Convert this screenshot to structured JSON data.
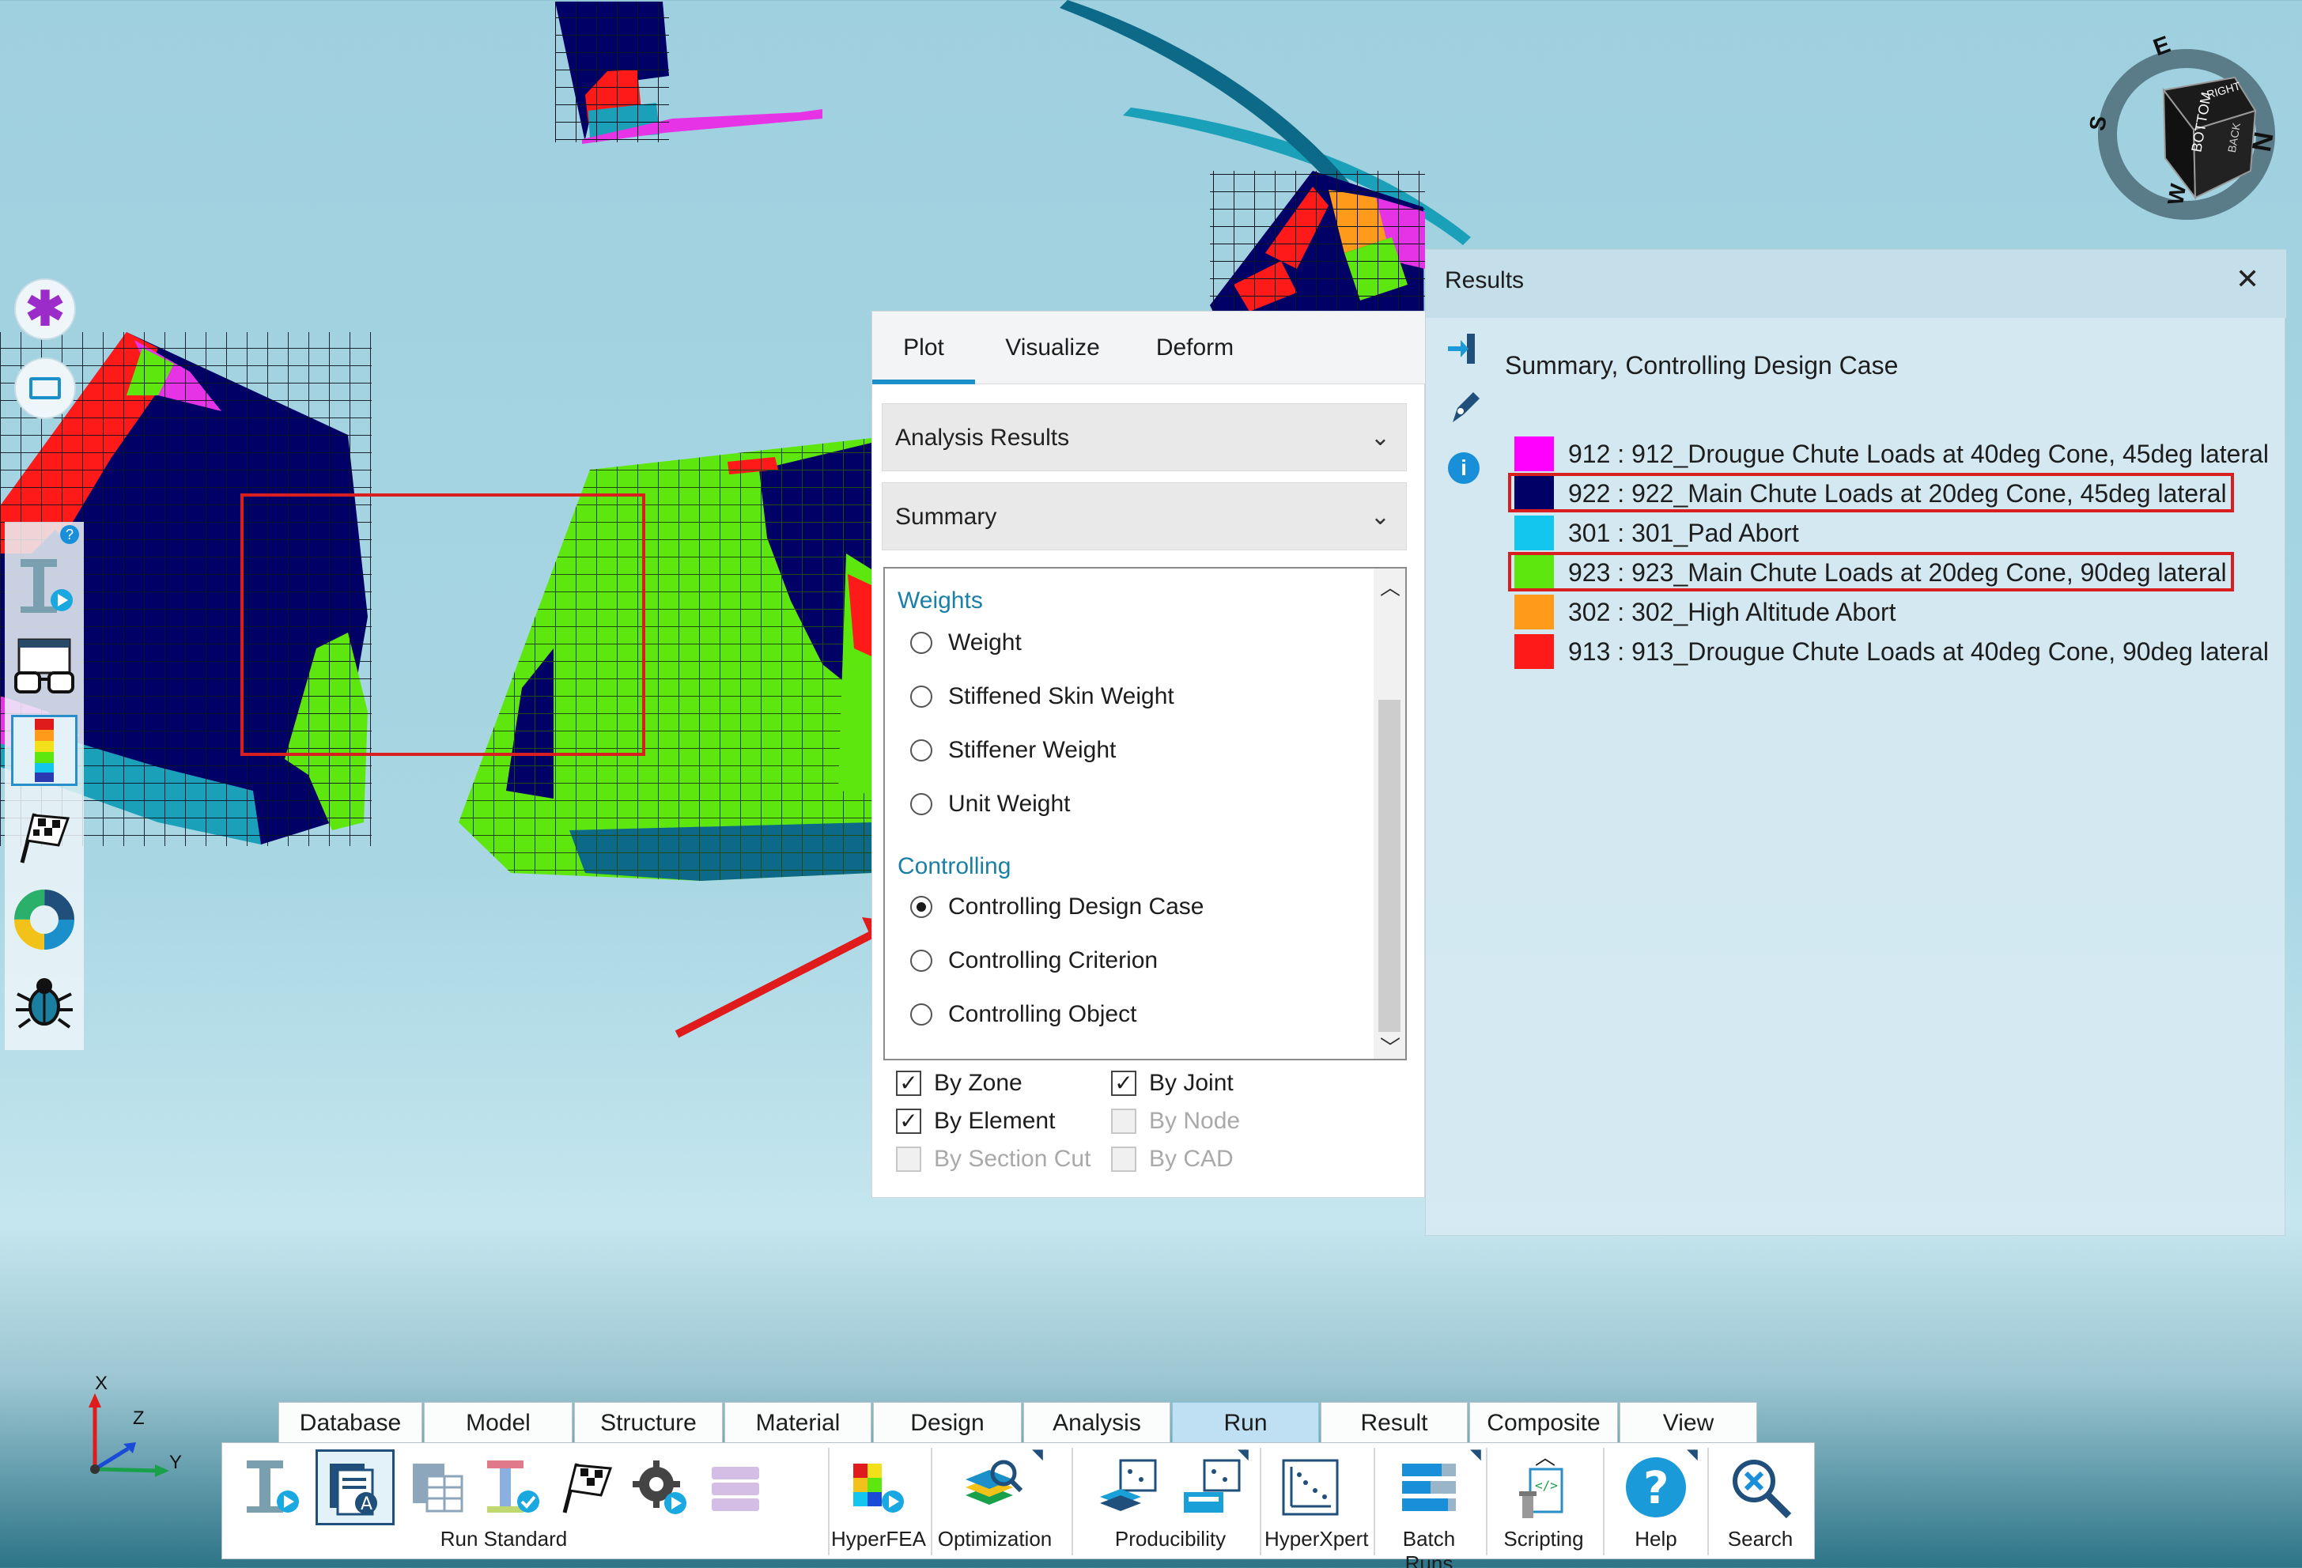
{
  "left_toolbar": {
    "help_badge": "?",
    "icons": [
      "asterisk-icon",
      "rectangle-icon",
      "run-icon",
      "glasses-icon",
      "color-legend-icon",
      "checkered-flag-icon",
      "donut-chart-icon",
      "bug-icon"
    ]
  },
  "plot_panel": {
    "tabs": [
      "Plot",
      "Visualize",
      "Deform"
    ],
    "active_tab": "Plot",
    "dropdown_1": "Analysis Results",
    "dropdown_2": "Summary",
    "sections": {
      "weights_header": "Weights",
      "weights": [
        "Weight",
        "Stiffened Skin Weight",
        "Stiffener Weight",
        "Unit Weight"
      ],
      "controlling_header": "Controlling",
      "controlling": [
        "Controlling Design Case",
        "Controlling Criterion",
        "Controlling Object"
      ],
      "selected": "Controlling Design Case"
    },
    "checkboxes": [
      {
        "label": "By Zone",
        "checked": true,
        "enabled": true
      },
      {
        "label": "By Joint",
        "checked": true,
        "enabled": true
      },
      {
        "label": "By Element",
        "checked": true,
        "enabled": true
      },
      {
        "label": "By Node",
        "checked": false,
        "enabled": false
      },
      {
        "label": "By Section Cut",
        "checked": false,
        "enabled": false
      },
      {
        "label": "By CAD",
        "checked": false,
        "enabled": false
      }
    ]
  },
  "results_panel": {
    "title": "Results",
    "close": "✕",
    "subtitle": "Summary, Controlling Design Case",
    "legend": [
      {
        "label": "912 : 912_Drougue Chute Loads at 40deg Cone, 45deg lateral",
        "color": "#ff00ff"
      },
      {
        "label": "922 : 922_Main Chute Loads at 20deg Cone, 45deg lateral",
        "color": "#000066"
      },
      {
        "label": "301 : 301_Pad Abort",
        "color": "#12c6ee"
      },
      {
        "label": "923 : 923_Main Chute Loads at 20deg Cone, 90deg lateral",
        "color": "#5de70f"
      },
      {
        "label": "302 : 302_High Altitude Abort",
        "color": "#ff9a1a"
      },
      {
        "label": "913 : 913_Drougue Chute Loads at 40deg Cone, 90deg lateral",
        "color": "#ff1a1a"
      }
    ]
  },
  "view_cube": {
    "face_bottom": "BOTTOM",
    "face_right": "RIGHT",
    "face_back": "BACK",
    "compass": [
      "E",
      "N",
      "S",
      "W"
    ]
  },
  "axis_triad": {
    "x": "X",
    "y": "Y",
    "z": "Z"
  },
  "ribbon": {
    "tabs": [
      "Database",
      "Model",
      "Structure",
      "Material",
      "Design",
      "Analysis",
      "Run",
      "Result",
      "Composite",
      "View"
    ],
    "active_tab": "Run",
    "groups": {
      "run_standard": "Run Standard",
      "hyperfea": "HyperFEA",
      "optimization": "Optimization",
      "producibility": "Producibility",
      "hyperxpert": "HyperXpert",
      "batch_runs": "Batch Runs",
      "scripting": "Scripting",
      "help": "Help",
      "search": "Search"
    }
  }
}
